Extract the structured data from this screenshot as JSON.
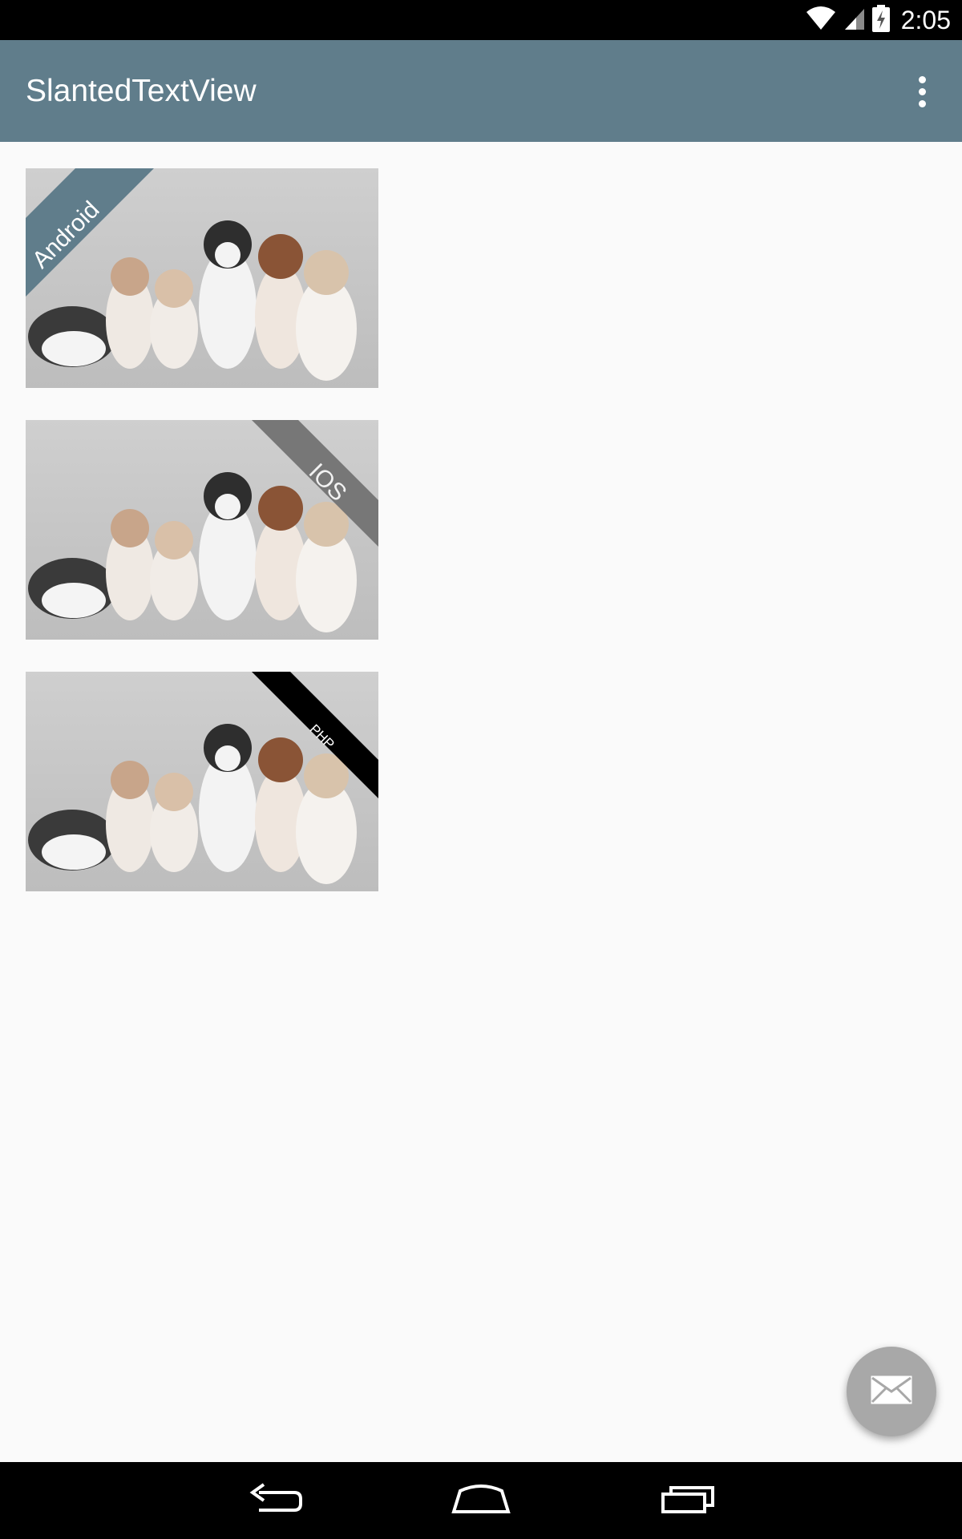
{
  "status_bar": {
    "time": "2:05",
    "icons": [
      "wifi-icon",
      "cell-signal-icon",
      "battery-charging-icon"
    ]
  },
  "app_bar": {
    "title": "SlantedTextView",
    "menu_icon": "overflow-menu-icon"
  },
  "cards": [
    {
      "label": "Android",
      "slant_color": "#607d8b",
      "corner": "top-left",
      "image": "husky-puppies-photo"
    },
    {
      "label": "IOS",
      "slant_color": "#777777",
      "corner": "top-right",
      "image": "husky-puppies-photo"
    },
    {
      "label": "PHP",
      "slant_color": "#000000",
      "corner": "top-right",
      "image": "husky-puppies-photo"
    }
  ],
  "fab": {
    "icon": "mail-icon",
    "color": "#a8a8a8"
  },
  "nav_bar": {
    "buttons": [
      "back-icon",
      "home-icon",
      "recent-apps-icon"
    ]
  }
}
